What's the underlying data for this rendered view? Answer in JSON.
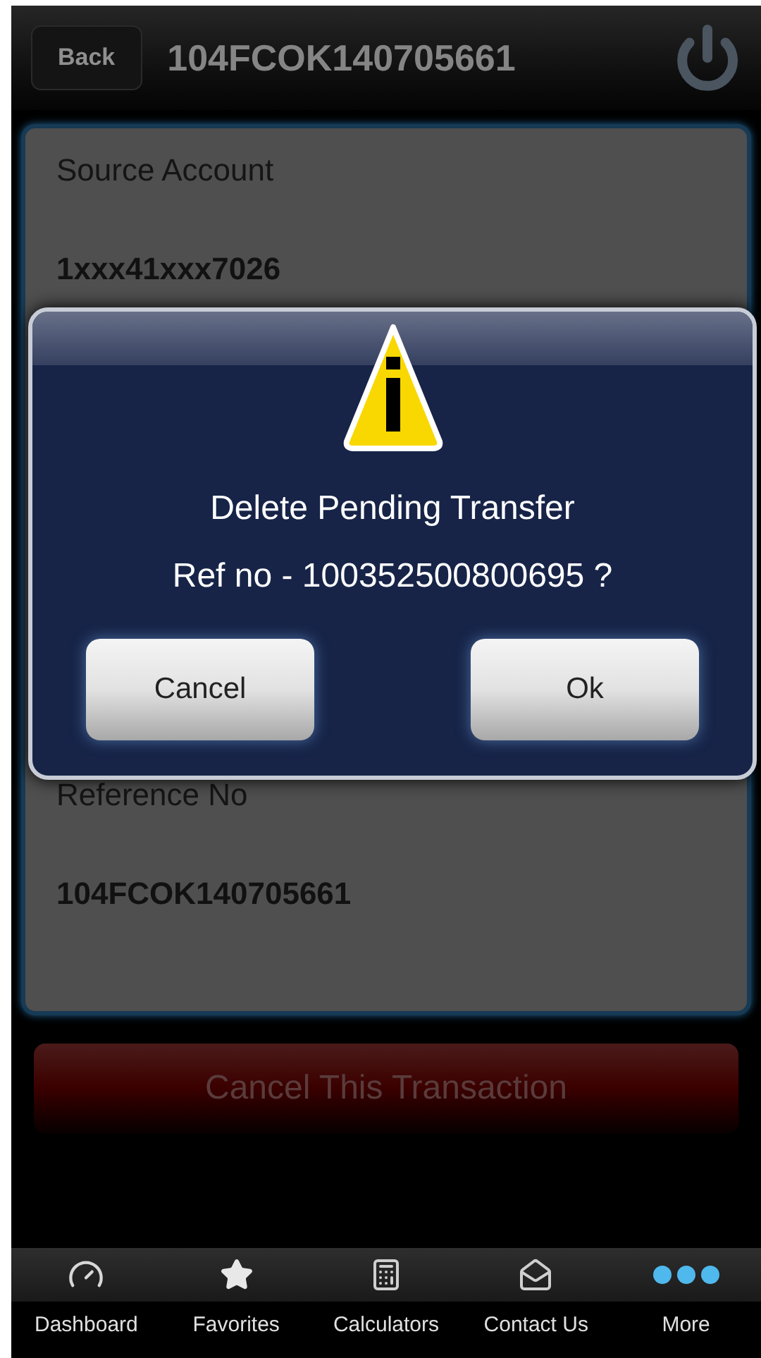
{
  "header": {
    "back": "Back",
    "title": "104FCOK140705661"
  },
  "fields": [
    {
      "label": "Source Account",
      "value": "1xxx41xxx7026"
    },
    {
      "label": "Reference No",
      "value": "104FCOK140705661"
    }
  ],
  "dialog": {
    "lines": [
      "Delete Pending Transfer",
      "Ref no - 100352500800695 ?"
    ],
    "buttons": [
      "Cancel",
      "Ok"
    ]
  },
  "action_button": "Cancel This Transaction",
  "tabs": [
    {
      "kind": "gauge",
      "label": "Dashboard"
    },
    {
      "kind": "star",
      "label": "Favorites"
    },
    {
      "kind": "calculator",
      "label": "Calculators"
    },
    {
      "kind": "mail",
      "label": "Contact Us"
    },
    {
      "kind": "dots",
      "label": "More"
    }
  ]
}
